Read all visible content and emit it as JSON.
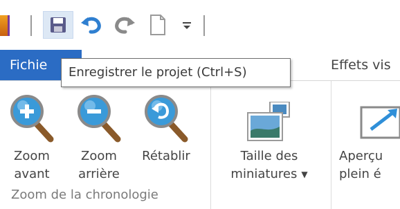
{
  "quick_access": {
    "app_icon": "app-logo-icon",
    "save_icon": "save-floppy-icon",
    "undo_icon": "undo-icon",
    "redo_icon": "redo-icon",
    "new_icon": "new-document-icon",
    "customize_icon": "customize-dropdown-icon"
  },
  "tabs": {
    "file_label": "Fichie",
    "effects_label": "Effets vis"
  },
  "tooltip": {
    "text": "Enregistrer le projet (Ctrl+S)"
  },
  "ribbon": {
    "zoom_in": {
      "line1": "Zoom",
      "line2": "avant"
    },
    "zoom_out": {
      "line1": "Zoom",
      "line2": "arrière"
    },
    "reset": {
      "line1": "Rétablir"
    },
    "thumbnails": {
      "line1": "Taille des",
      "line2": "miniatures"
    },
    "fullscreen": {
      "line1": "Aperçu",
      "line2": "plein é"
    },
    "group_label": "Zoom de la chronologie"
  },
  "colors": {
    "accent": "#2b6cc4",
    "magnifier_blue": "#3a9ad9",
    "handle_brown": "#8a5a2a"
  }
}
